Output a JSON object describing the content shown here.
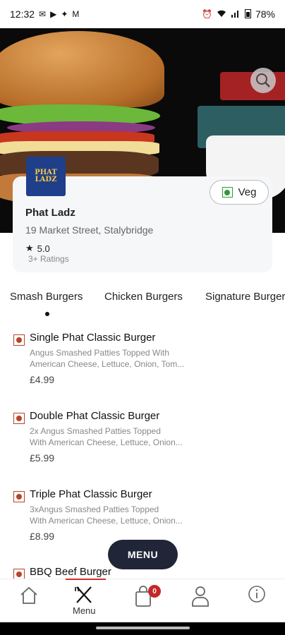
{
  "status_bar": {
    "time": "12:32",
    "battery": "78%",
    "left_icons": [
      "sms-icon",
      "youtube-icon",
      "app-icon",
      "app-icon",
      "mail-icon"
    ],
    "right_icons": [
      "alarm-icon",
      "vibrate-icon",
      "signal-icon",
      "wifi-icon",
      "signal-icon",
      "signal-icon",
      "battery-icon"
    ]
  },
  "restaurant": {
    "logo_text": "PHAT LADZ",
    "name": "Phat Ladz",
    "address": "19 Market Street, Stalybridge",
    "rating": "5.0",
    "rating_count": "3+ Ratings",
    "veg_label": "Veg"
  },
  "categories": [
    {
      "label": "Smash Burgers",
      "active": true
    },
    {
      "label": "Chicken Burgers",
      "active": false
    },
    {
      "label": "Signature Burgers",
      "active": false
    }
  ],
  "menu_items": [
    {
      "name": "Single Phat Classic Burger",
      "desc_line1": "Angus Smashed Patties Topped With",
      "desc_line2": "American Cheese, Lettuce, Onion, Tom...",
      "price": "£4.99"
    },
    {
      "name": "Double Phat Classic Burger",
      "desc_line1": "2x Angus Smashed Patties Topped",
      "desc_line2": "With American Cheese, Lettuce, Onion...",
      "price": "£5.99"
    },
    {
      "name": "Triple Phat Classic Burger",
      "desc_line1": "3xAngus Smashed Patties Topped",
      "desc_line2": "With American Cheese, Lettuce, Onion...",
      "price": "£8.99"
    },
    {
      "name": "BBQ Beef Burger"
    }
  ],
  "floating_button": {
    "label": "MENU"
  },
  "bottom_nav": {
    "items": [
      {
        "icon": "home-icon"
      },
      {
        "icon": "fork-knife-icon",
        "label": "Menu"
      },
      {
        "icon": "bag-icon",
        "badge": "0"
      },
      {
        "icon": "person-icon"
      },
      {
        "icon": "info-icon"
      }
    ]
  },
  "colors": {
    "accent": "#d32f2f",
    "nonveg": "#b5452b",
    "veg": "#2e9a3a",
    "fab": "#202538"
  }
}
